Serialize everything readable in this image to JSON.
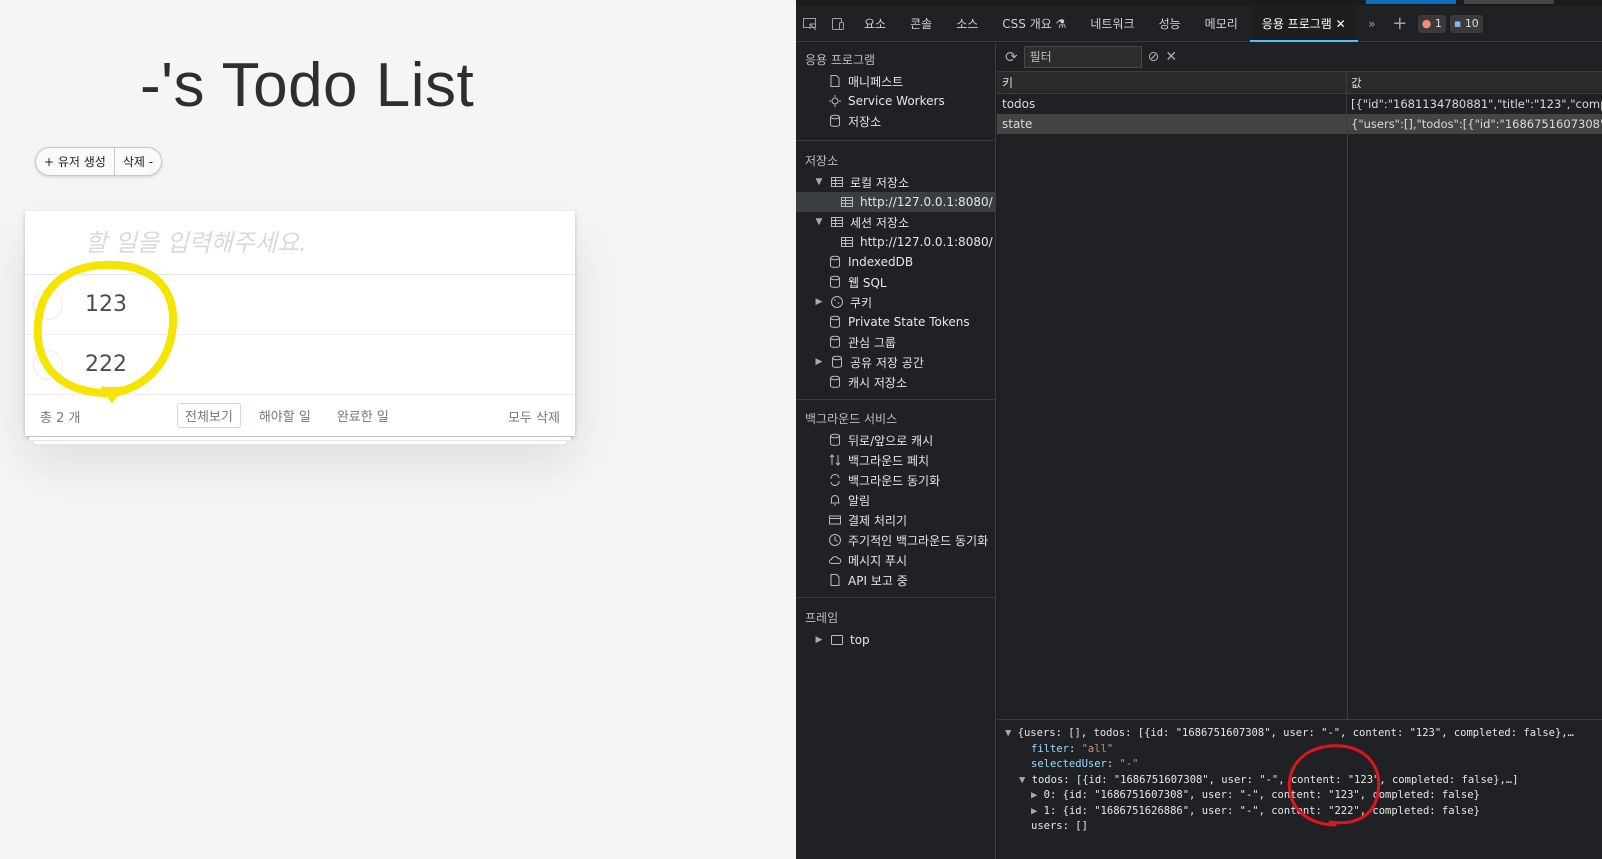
{
  "app": {
    "title": "-'s Todo List",
    "user_buttons": {
      "create": "+ 유저 생성",
      "delete": "삭제 -"
    },
    "input_placeholder": "할 일을 입력해주세요.",
    "todos": [
      {
        "text": "123"
      },
      {
        "text": "222"
      }
    ],
    "footer": {
      "count": "총 2 개",
      "filters": [
        "전체보기",
        "해야할 일",
        "완료한 일"
      ],
      "selected_filter": "전체보기",
      "clear_all": "모두 삭제"
    }
  },
  "devtools": {
    "tabs": [
      "요소",
      "콘솔",
      "소스",
      "CSS 개요",
      "네트워크",
      "성능",
      "메모리",
      "응용 프로그램"
    ],
    "active_tab": "응용 프로그램",
    "error_count": "1",
    "message_count": "10",
    "sidebar": {
      "app_section": "응용 프로그램",
      "app_items": [
        "매니페스트",
        "Service Workers",
        "저장소"
      ],
      "storage_section": "저장소",
      "local_storage": "로컬 저장소",
      "local_storage_origin": "http://127.0.0.1:8080/",
      "session_storage": "세션 저장소",
      "session_storage_origin": "http://127.0.0.1:8080/",
      "storage_items": [
        "IndexedDB",
        "웹 SQL",
        "쿠키",
        "Private State Tokens",
        "관심 그룹",
        "공유 저장 공간",
        "캐시 저장소"
      ],
      "bg_section": "백그라운드 서비스",
      "bg_items": [
        "뒤로/앞으로 캐시",
        "백그라운드 페치",
        "백그라운드 동기화",
        "알림",
        "결제 처리기",
        "주기적인 백그라운드 동기화",
        "메시지 푸시",
        "API 보고 중"
      ],
      "frames_section": "프레임",
      "frames_items": [
        "top"
      ]
    },
    "storage_view": {
      "filter_placeholder": "필터",
      "key_header": "키",
      "value_header": "값",
      "rows": [
        {
          "key": "todos",
          "value": "[{\"id\":\"1681134780881\",\"title\":\"123\",\"complete"
        },
        {
          "key": "state",
          "value": "{\"users\":[],\"todos\":[{\"id\":\"1686751607308\",\"use"
        }
      ]
    },
    "preview": {
      "line1": "{users: [], todos: [{id: \"1686751607308\", user: \"-\", content: \"123\", completed: false},…",
      "filter_key": "filter",
      "filter_val": "\"all\"",
      "selected_key": "selectedUser",
      "selected_val": "\"-\"",
      "todos_line": "todos: [{id: \"1686751607308\", user: \"-\", content: \"123\", completed: false},…]",
      "todo0": "0: {id: \"1686751607308\", user: \"-\", content: \"123\", completed: false}",
      "todo1": "1: {id: \"1686751626886\", user: \"-\", content: \"222\", completed: false}",
      "users_line": "users: []"
    }
  },
  "colors": {
    "highlight_yellow": "#f4e400",
    "highlight_red": "#e0141e",
    "devtools_bg": "#202124",
    "active_tab_accent": "#4fc1ff"
  }
}
